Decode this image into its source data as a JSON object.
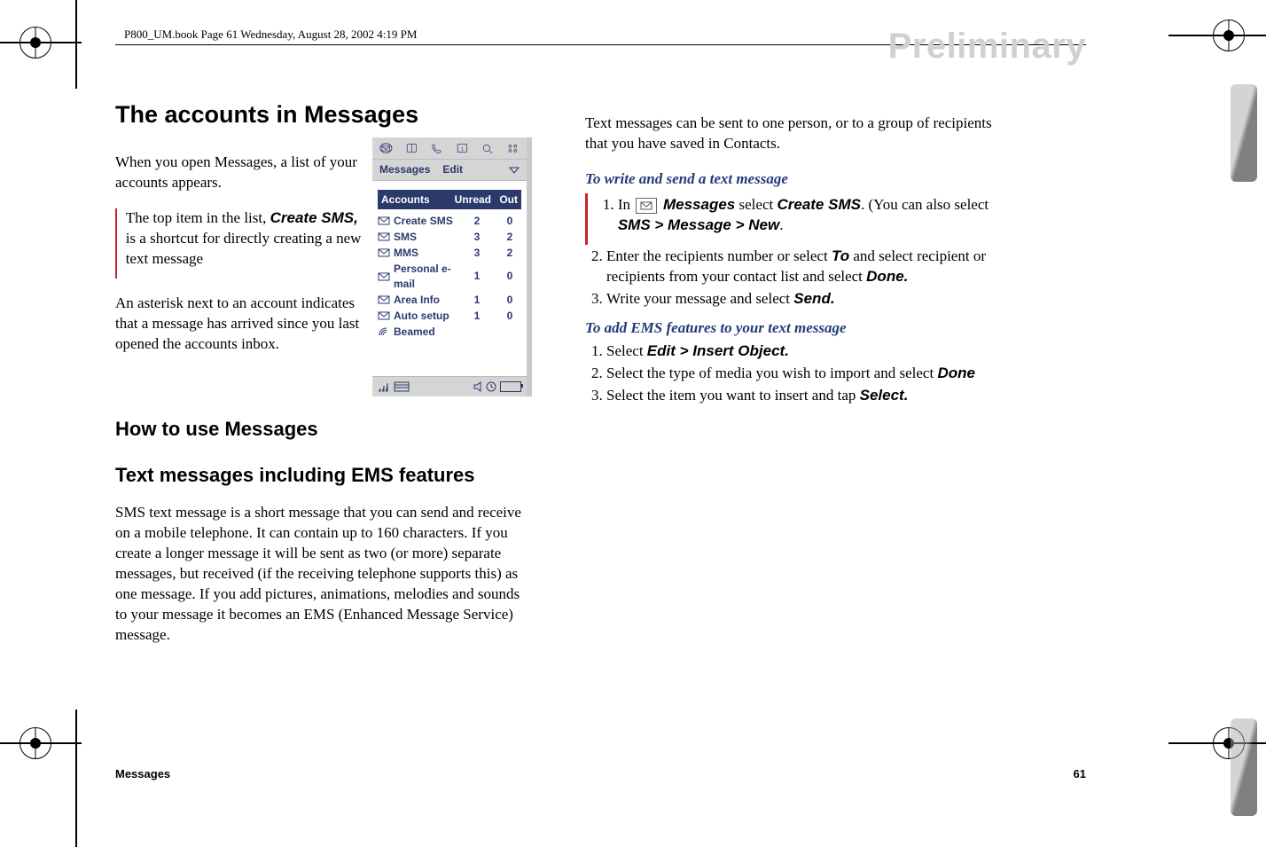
{
  "header": {
    "book_info": "P800_UM.book  Page 61  Wednesday, August 28, 2002  4:19 PM"
  },
  "watermark": "Preliminary",
  "left": {
    "h_accounts": "The accounts in Messages",
    "p1_a": "When you open Messages, a list of your accounts appears.",
    "p1_b_pre": "The top item in the list, ",
    "p1_b_bold": "Create SMS,",
    "p1_b_post": " is a shortcut for directly creating a new text message",
    "p2": "An asterisk next to an account indicates that a message has arrived since you last opened the accounts inbox.",
    "h_how": "How to use Messages",
    "h_text": "Text messages including EMS features",
    "p3": "SMS text message is a short message that you can send and receive on a mobile telephone. It can contain up to 160 characters. If you create a longer message it will be sent as two (or more) separate messages, but received (if the receiving telephone supports this) as one message. If you add pictures, animations, melodies and sounds to your message it becomes an EMS (Enhanced Message Service) message."
  },
  "phone": {
    "menu_messages": "Messages",
    "menu_edit": "Edit",
    "col_accounts": "Accounts",
    "col_unread": "Unread",
    "col_out": "Out",
    "rows": [
      {
        "label": "Create SMS",
        "unread": "2",
        "out": "0"
      },
      {
        "label": "SMS",
        "unread": "3",
        "out": "2"
      },
      {
        "label": "MMS",
        "unread": "3",
        "out": "2"
      },
      {
        "label": "Personal e-mail",
        "unread": "1",
        "out": "0"
      },
      {
        "label": "Area Info",
        "unread": "1",
        "out": "0"
      },
      {
        "label": "Auto setup",
        "unread": "1",
        "out": "0"
      },
      {
        "label": "Beamed",
        "unread": "",
        "out": ""
      }
    ]
  },
  "right": {
    "p_intro": "Text messages can be sent to one person, or to a group of recipients that you have saved in Contacts.",
    "sub_write": "To write and send a text message",
    "w1_pre": "In ",
    "w1_mid1": " Messages",
    "w1_mid2": " select ",
    "w1_mid3": "Create SMS",
    "w1_mid4": ".  (You can also select ",
    "w1_bold2": "SMS > Message > New",
    "w1_end": ".",
    "w2_pre": "Enter the recipients number or select ",
    "w2_b1": "To",
    "w2_mid": " and select recipient or recipients from your contact list and select ",
    "w2_b2": "Done.",
    "w3_pre": "Write your message and select ",
    "w3_b": "Send.",
    "sub_ems": "To add EMS features to your text message",
    "e1_pre": "Select ",
    "e1_b": "Edit > Insert Object.",
    "e2_pre": "Select the type of media you wish to import and select ",
    "e2_b": "Done",
    "e3_pre": "Select the item you want to insert and tap ",
    "e3_b": "Select."
  },
  "footer": {
    "left": "Messages",
    "right": "61"
  }
}
